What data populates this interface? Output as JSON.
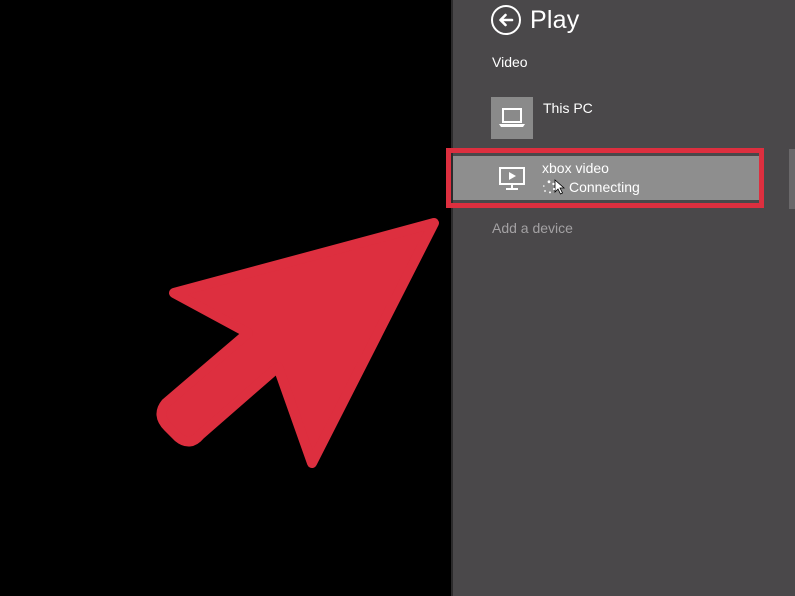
{
  "colors": {
    "background": "#000000",
    "panel": "#4a484a",
    "tile": "#8a8a8a",
    "selected_row": "#8e8e8e",
    "highlight": "#dd2f3f",
    "arrow": "#dd2f3f",
    "muted_text": "#a3a1a3"
  },
  "panel": {
    "title": "Play",
    "back_icon": "back-arrow-circle-icon",
    "section_label": "Video",
    "devices": [
      {
        "name": "This PC",
        "icon": "laptop-icon",
        "status": ""
      },
      {
        "name": "xbox video",
        "icon": "monitor-play-icon",
        "status": "Connecting"
      }
    ],
    "add_device": "Add a device"
  },
  "annotations": {
    "pointer_arrow": "red-arrow-icon",
    "highlight_target": "xbox video"
  }
}
